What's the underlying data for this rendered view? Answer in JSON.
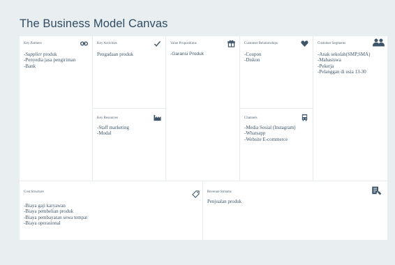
{
  "title": "The Business Model Canvas",
  "colors": {
    "background": "#e9eef1",
    "board": "#ffffff",
    "text": "#3a5266",
    "icon": "#3e5468"
  },
  "blocks": {
    "key_partners": {
      "heading": "Key Partners",
      "icon": "link-icon",
      "items": [
        {
          "em": "Supplier",
          "rest": " produk",
          "prefix": "-"
        },
        "-Penyedia jasa pengiriman",
        "-Bank"
      ]
    },
    "key_activities": {
      "heading": "Key Activities",
      "icon": "check-icon",
      "items": [
        "Pengadaan produk"
      ]
    },
    "key_resources": {
      "heading": "Key Resources",
      "icon": "factory-icon",
      "items": [
        "-Staff marketing",
        "-Modal"
      ]
    },
    "value_propositions": {
      "heading": "Value Propositions",
      "icon": "gift-icon",
      "items": [
        "-Garansi Produk"
      ]
    },
    "customer_relationships": {
      "heading": "Customer Relationships",
      "icon": "heart-icon",
      "items": [
        "-Coupon",
        "-Diskon"
      ]
    },
    "channels": {
      "heading": "Channels",
      "icon": "bus-icon",
      "items": [
        "-Media Sosial (Instagram)",
        "-Whatsapp",
        "-Website E-commerce"
      ]
    },
    "customer_segments": {
      "heading": "Customer Segments",
      "icon": "users-icon",
      "items": [
        "-Anak sekolah(SMP,SMA)",
        "-Mahasiswa",
        "-Pekerja",
        "-Pelanggan di usia 13-30"
      ]
    },
    "cost_structure": {
      "heading": "Cost Structure",
      "icon": "tag-icon",
      "items": [
        "-Biaya gaji karyawan",
        "-Biaya pembelian produk",
        "-Biaya pembayaran sewa tempat",
        "-Biaya operasional"
      ]
    },
    "revenue_streams": {
      "heading": "Revenue Streams",
      "icon": "revenue-icon",
      "items": [
        "Penjualan produk"
      ]
    }
  }
}
